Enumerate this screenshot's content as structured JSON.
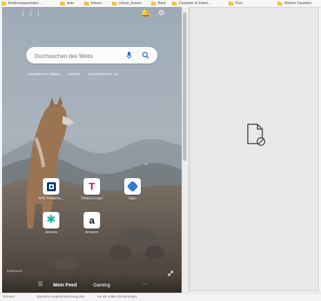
{
  "bookmarks": [
    {
      "label": "Bedienungsanleitun..."
    },
    {
      "label": "Auto"
    },
    {
      "label": "Reisen"
    },
    {
      "label": "Urlaub_Reisen"
    },
    {
      "label": "Bank"
    },
    {
      "label": "Computer & Zuben..."
    },
    {
      "label": "Post"
    },
    {
      "label": "Weitere Favoriten"
    }
  ],
  "top_icons": {
    "apps": "apps-grid-icon",
    "notifications": "bell-icon",
    "settings": "gear-icon"
  },
  "search": {
    "placeholder": "Durchsuchen des Webs"
  },
  "quick_links": [
    "verwalten von dateisc...",
    "autofact",
    "synchronisieren von...",
    "..."
  ],
  "tiles": [
    {
      "label": "ARD Mediathe...",
      "icon": "ard-icon",
      "accent": "#003a73"
    },
    {
      "label": "Telekom Login",
      "icon": "telekom-icon",
      "accent": "#e20074"
    },
    {
      "label": "Apps",
      "icon": "apps-icon",
      "accent": "#2e7bd7"
    },
    {
      "label": "Jameda",
      "icon": "jameda-icon",
      "accent": "#1bb59a"
    },
    {
      "label": "Amazon",
      "icon": "amazon-icon",
      "accent": "#111111"
    }
  ],
  "impressum": "Impressum",
  "feed": {
    "menu_icon": "menu-icon",
    "tabs": [
      "Mein Feed",
      "Gaming"
    ],
    "grid_icon": "grid-icon"
  },
  "bottom_bar": [
    "Demeter",
    "Ubersicht Ausgleichsrechnung.xlsx",
    "nur die sollten Sie beruhigen"
  ],
  "right_panel": {
    "icon": "blocked-document-icon"
  }
}
